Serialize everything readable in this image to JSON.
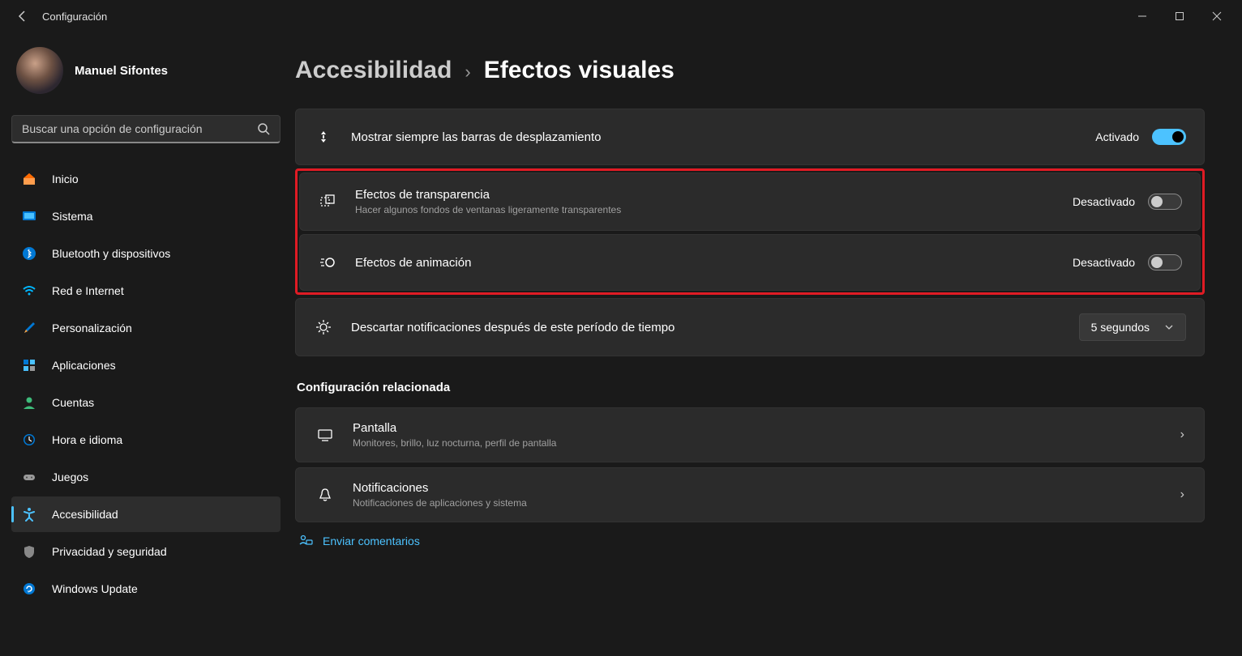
{
  "titlebar": {
    "app_name": "Configuración"
  },
  "profile": {
    "name": "Manuel Sifontes"
  },
  "search": {
    "placeholder": "Buscar una opción de configuración"
  },
  "nav": {
    "items": [
      {
        "label": "Inicio"
      },
      {
        "label": "Sistema"
      },
      {
        "label": "Bluetooth y dispositivos"
      },
      {
        "label": "Red e Internet"
      },
      {
        "label": "Personalización"
      },
      {
        "label": "Aplicaciones"
      },
      {
        "label": "Cuentas"
      },
      {
        "label": "Hora e idioma"
      },
      {
        "label": "Juegos"
      },
      {
        "label": "Accesibilidad"
      },
      {
        "label": "Privacidad y seguridad"
      },
      {
        "label": "Windows Update"
      }
    ]
  },
  "breadcrumb": {
    "parent": "Accesibilidad",
    "current": "Efectos visuales"
  },
  "settings": {
    "scrollbars": {
      "title": "Mostrar siempre las barras de desplazamiento",
      "state": "Activado"
    },
    "transparency": {
      "title": "Efectos de transparencia",
      "desc": "Hacer algunos fondos de ventanas ligeramente transparentes",
      "state": "Desactivado"
    },
    "animation": {
      "title": "Efectos de animación",
      "state": "Desactivado"
    },
    "notifications_timeout": {
      "title": "Descartar notificaciones después de este período de tiempo",
      "value": "5 segundos"
    }
  },
  "related": {
    "heading": "Configuración relacionada",
    "display": {
      "title": "Pantalla",
      "desc": "Monitores, brillo, luz nocturna, perfil de pantalla"
    },
    "notifications": {
      "title": "Notificaciones",
      "desc": "Notificaciones de aplicaciones y sistema"
    }
  },
  "feedback": {
    "label": "Enviar comentarios"
  }
}
